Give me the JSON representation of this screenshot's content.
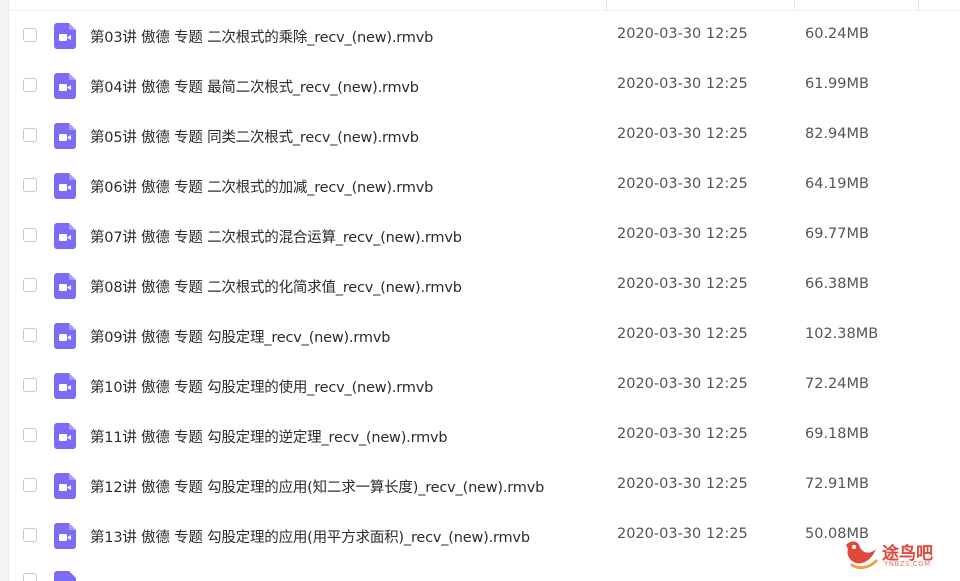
{
  "files": [
    {
      "name": "第03讲 傲德 专题 二次根式的乘除_recv_(new).rmvb",
      "date": "2020-03-30 12:25",
      "size": "60.24MB"
    },
    {
      "name": "第04讲 傲德 专题 最简二次根式_recv_(new).rmvb",
      "date": "2020-03-30 12:25",
      "size": "61.99MB"
    },
    {
      "name": "第05讲 傲德 专题 同类二次根式_recv_(new).rmvb",
      "date": "2020-03-30 12:25",
      "size": "82.94MB"
    },
    {
      "name": "第06讲 傲德 专题 二次根式的加减_recv_(new).rmvb",
      "date": "2020-03-30 12:25",
      "size": "64.19MB"
    },
    {
      "name": "第07讲 傲德 专题 二次根式的混合运算_recv_(new).rmvb",
      "date": "2020-03-30 12:25",
      "size": "69.77MB"
    },
    {
      "name": "第08讲 傲德 专题 二次根式的化简求值_recv_(new).rmvb",
      "date": "2020-03-30 12:25",
      "size": "66.38MB"
    },
    {
      "name": "第09讲 傲德 专题 勾股定理_recv_(new).rmvb",
      "date": "2020-03-30 12:25",
      "size": "102.38MB"
    },
    {
      "name": "第10讲 傲德 专题 勾股定理的使用_recv_(new).rmvb",
      "date": "2020-03-30 12:25",
      "size": "72.24MB"
    },
    {
      "name": "第11讲 傲德 专题 勾股定理的逆定理_recv_(new).rmvb",
      "date": "2020-03-30 12:25",
      "size": "69.18MB"
    },
    {
      "name": "第12讲 傲德 专题 勾股定理的应用(知二求一算长度)_recv_(new).rmvb",
      "date": "2020-03-30 12:25",
      "size": "72.91MB"
    },
    {
      "name": "第13讲 傲德 专题 勾股定理的应用(用平方求面积)_recv_(new).rmvb",
      "date": "2020-03-30 12:25",
      "size": "50.08MB"
    }
  ],
  "colors": {
    "video_icon": "#7b6cf6",
    "watermark": "#e0483a"
  },
  "icons": {
    "file_type": "video-file-icon",
    "checkbox": "checkbox-icon"
  },
  "watermark": {
    "text": "途鸟吧",
    "sub": "YNBZS.COM"
  }
}
